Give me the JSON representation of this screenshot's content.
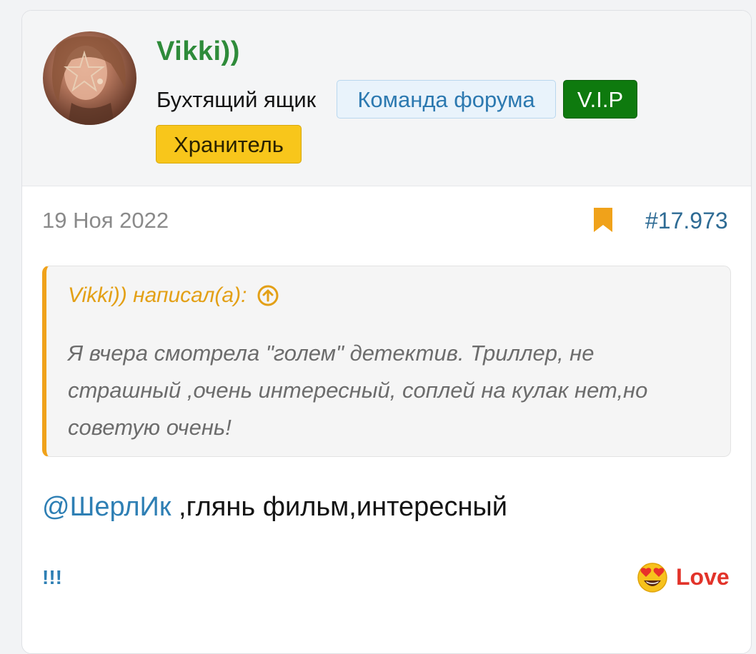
{
  "user": {
    "name": "Vikki))",
    "title": "Бухтящий ящик",
    "badges": {
      "team": "Команда форума",
      "vip": "V.I.P",
      "keeper": "Хранитель"
    }
  },
  "post": {
    "date": "19 Ноя 2022",
    "number": "#17.973",
    "bookmark_icon": "bookmark-icon"
  },
  "quote": {
    "author_line": "Vikki)) написал(а):",
    "text": "Я вчера смотрела \"голем\" детектив. Триллер, не страшный ,очень интересный, соплей на кулак нет,но советую очень!"
  },
  "message": {
    "mention": "@ШерлИк",
    "text": " ,глянь фильм,интересный"
  },
  "footer": {
    "bangs": "!!!",
    "reaction_label": "Love",
    "reaction_icon": "heart-eyes-emoji-icon"
  },
  "colors": {
    "username": "#2e8b3a",
    "accent_orange": "#f0a21a",
    "link_blue": "#2e7fb4",
    "vip_green": "#0e7a0e",
    "keeper_yellow": "#f8c61b",
    "love_red": "#e2332a"
  }
}
